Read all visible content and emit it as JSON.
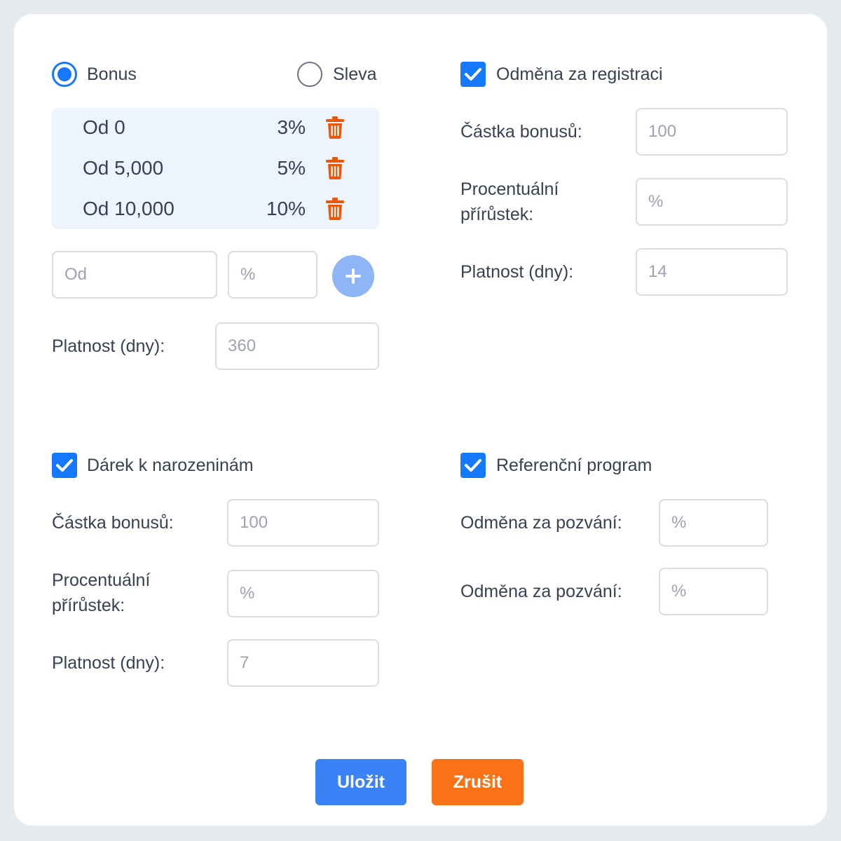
{
  "type_selector": {
    "bonus_label": "Bonus",
    "discount_label": "Sleva",
    "selected": "Bonus"
  },
  "tiers": [
    {
      "from": "Od 0",
      "percent": "3%"
    },
    {
      "from": "Od 5,000",
      "percent": "5%"
    },
    {
      "from": "Od 10,000",
      "percent": "10%"
    }
  ],
  "new_tier": {
    "from_placeholder": "Od",
    "percent_placeholder": "%"
  },
  "bonus_validity": {
    "label": "Platnost (dny):",
    "value": "360"
  },
  "registration_reward": {
    "checkbox_label": "Odměna za registraci",
    "checked": true,
    "amount_label": "Částka bonusů:",
    "amount_value": "100",
    "percent_label": "Procentuální přírůstek:",
    "percent_placeholder": "%",
    "validity_label": "Platnost (dny):",
    "validity_value": "14"
  },
  "birthday_gift": {
    "checkbox_label": "Dárek k narozeninám",
    "checked": true,
    "amount_label": "Částka bonusů:",
    "amount_value": "100",
    "percent_label": "Procentuální přírůstek:",
    "percent_placeholder": "%",
    "validity_label": "Platnost (dny):",
    "validity_value": "7"
  },
  "referral_program": {
    "checkbox_label": "Referenční program",
    "checked": true,
    "reward_label_1": "Odměna za pozvání:",
    "reward_placeholder_1": "%",
    "reward_label_2": "Odměna za pozvání:",
    "reward_placeholder_2": "%"
  },
  "actions": {
    "save_label": "Uložit",
    "cancel_label": "Zrušit"
  },
  "colors": {
    "accent": "#1677ff",
    "save": "#3b82f6",
    "cancel": "#f97316",
    "trash": "#ea580c",
    "tiers_bg": "#edf4fd"
  },
  "icons": {
    "trash": "trash-icon",
    "add": "plus-icon",
    "check": "checkmark-icon"
  }
}
